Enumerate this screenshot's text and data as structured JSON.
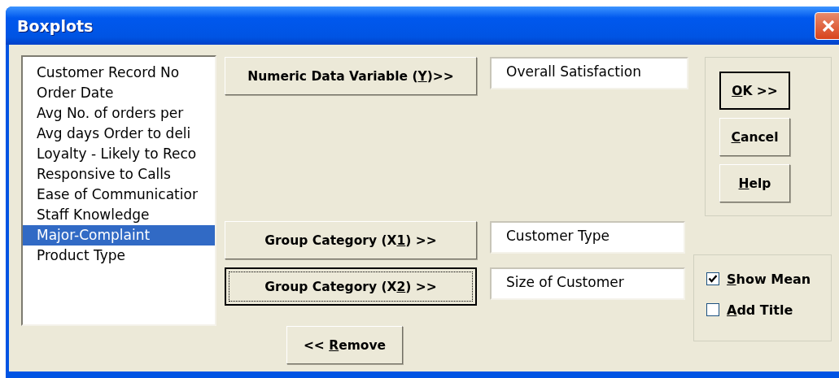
{
  "window": {
    "title": "Boxplots"
  },
  "variables": [
    {
      "label": "Customer Record No",
      "selected": false
    },
    {
      "label": "Order Date",
      "selected": false
    },
    {
      "label": "Avg No. of orders per",
      "selected": false
    },
    {
      "label": "Avg days Order to deli",
      "selected": false
    },
    {
      "label": "Loyalty - Likely to Reco",
      "selected": false
    },
    {
      "label": "Responsive to Calls",
      "selected": false
    },
    {
      "label": "Ease of Communicatior",
      "selected": false
    },
    {
      "label": "Staff Knowledge",
      "selected": false
    },
    {
      "label": "Major-Complaint",
      "selected": true
    },
    {
      "label": "Product Type",
      "selected": false
    }
  ],
  "assignments": [
    {
      "button": {
        "pre": "Numeric Data Variable (",
        "key": "Y",
        "post": ")>>",
        "focused": false
      },
      "value": "Overall Satisfaction"
    },
    {
      "button": {
        "pre": "Group Category (X",
        "key": "1",
        "post": ") >>",
        "focused": false
      },
      "value": "Customer Type"
    },
    {
      "button": {
        "pre": "Group Category (X",
        "key": "2",
        "post": ") >>",
        "focused": true
      },
      "value": "Size of Customer"
    }
  ],
  "remove_button": {
    "pre": "<< ",
    "key": "R",
    "post": "emove",
    "focused": false
  },
  "actions": [
    {
      "key": "O",
      "post": "K >>",
      "default": true
    },
    {
      "key": "C",
      "post": "ancel",
      "default": false
    },
    {
      "key": "H",
      "post": "elp",
      "default": false
    }
  ],
  "options": [
    {
      "key": "S",
      "post": "how Mean",
      "checked": true
    },
    {
      "key": "A",
      "post": "dd Title",
      "checked": false
    }
  ]
}
